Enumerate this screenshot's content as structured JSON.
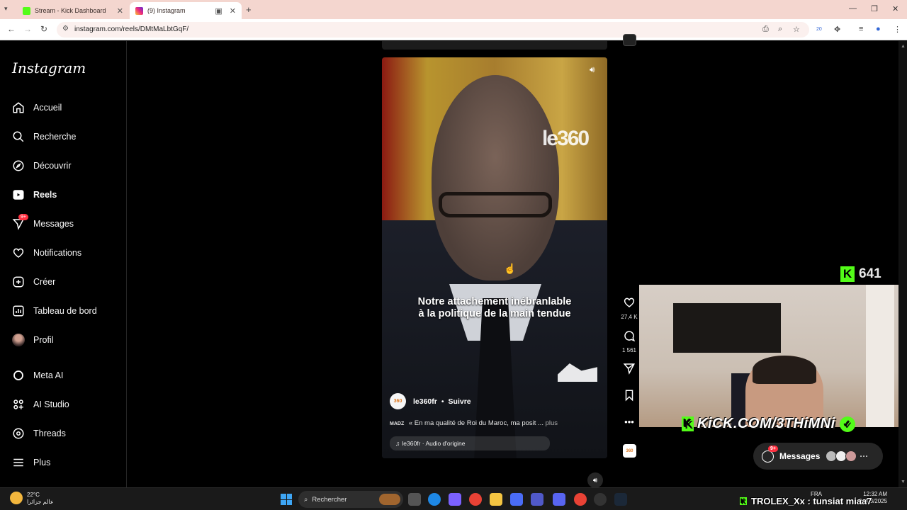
{
  "browser": {
    "tabs": [
      {
        "title": "Stream - Kick Dashboard",
        "active": false,
        "favicon_color": "#53fc18"
      },
      {
        "title": "(9) Instagram",
        "active": true,
        "favicon_color": "#d6249f"
      }
    ],
    "url": "instagram.com/reels/DMtMaLbtGqF/",
    "extension_badge": "20"
  },
  "instagram": {
    "logo": "Instagram",
    "nav": [
      {
        "label": "Accueil",
        "icon": "home-icon"
      },
      {
        "label": "Recherche",
        "icon": "search-icon"
      },
      {
        "label": "Découvrir",
        "icon": "compass-icon"
      },
      {
        "label": "Reels",
        "icon": "reels-icon",
        "active": true
      },
      {
        "label": "Messages",
        "icon": "messages-icon",
        "badge": "9+"
      },
      {
        "label": "Notifications",
        "icon": "heart-icon"
      },
      {
        "label": "Créer",
        "icon": "plus-square-icon"
      },
      {
        "label": "Tableau de bord",
        "icon": "dashboard-icon"
      },
      {
        "label": "Profil",
        "icon": "avatar"
      },
      {
        "label": "Meta AI",
        "icon": "meta-ai-icon"
      },
      {
        "label": "AI Studio",
        "icon": "ai-studio-icon"
      },
      {
        "label": "Threads",
        "icon": "threads-icon"
      },
      {
        "label": "Plus",
        "icon": "menu-icon"
      }
    ]
  },
  "reel": {
    "watermark": "le360",
    "subtitle_line1": "Notre attachement inébranlable",
    "subtitle_line2": "à la politique de la main tendue",
    "author_avatar_text": "360",
    "author": "le360fr",
    "separator": "•",
    "follow_label": "Suivre",
    "caption_tag": "MADZ",
    "caption": "« En ma qualité de Roi du Maroc, ma posit",
    "caption_ellipsis": "...",
    "more_label": "plus",
    "audio_icon": "♫",
    "audio": "le360fr · Audio d'origine",
    "likes": "27,4 K",
    "comments": "1 561",
    "thumb_text": "360"
  },
  "stream_overlay": {
    "viewer_count": "641",
    "kick_url": "KiCK.COM/3THiMNi",
    "messages_label": "Messages",
    "messages_badge": "9+",
    "chat_line": "TROLEX_Xx : tunsiat miaa7"
  },
  "taskbar": {
    "temperature": "22°C",
    "weather_text": "عالم جزائرا",
    "search_label": "Rechercher",
    "language": "FRA",
    "time": "12:32 AM",
    "date": "02/08/2025"
  },
  "colors": {
    "kick_green": "#53fc18",
    "instagram_badge": "#ff3040",
    "tab_strip": "#f4d6cf"
  }
}
